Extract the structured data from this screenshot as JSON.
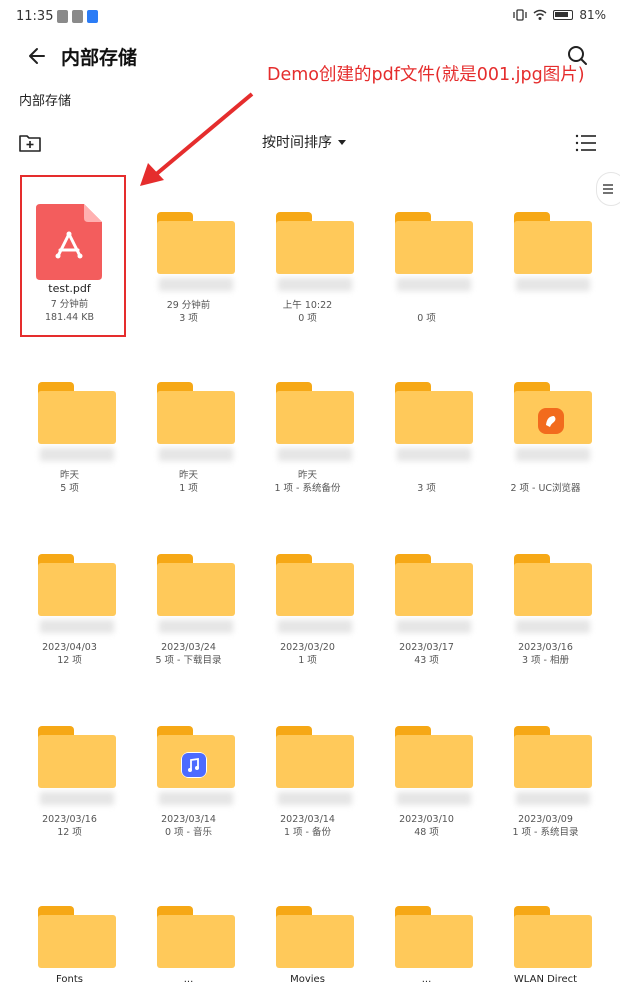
{
  "status_bar": {
    "time": "11:35",
    "battery": "81%"
  },
  "header": {
    "title": "内部存储"
  },
  "breadcrumb": {
    "path": "内部存储"
  },
  "toolbar": {
    "sort_label": "按时间排序"
  },
  "annotation": {
    "text": "Demo创建的pdf文件(就是001.jpg图片)"
  },
  "items": [
    {
      "name": "test.pdf",
      "date": "7 分钟前",
      "count": "181.44 KB"
    },
    {
      "name": "",
      "date": "29 分钟前",
      "count": "3 项"
    },
    {
      "name": "",
      "date": "上午 10:22",
      "count": "0 项"
    },
    {
      "name": "",
      "date": "",
      "count": "0 项"
    },
    {
      "name": "",
      "date": "",
      "count": ""
    },
    {
      "name": "",
      "date": "昨天",
      "count": "5 项"
    },
    {
      "name": "",
      "date": "昨天",
      "count": "1 项"
    },
    {
      "name": "",
      "date": "昨天",
      "count": "1 项 - 系统备份"
    },
    {
      "name": "",
      "date": "",
      "count": "3 项"
    },
    {
      "name": "",
      "date": "",
      "count": "2 项 - UC浏览器"
    },
    {
      "name": "",
      "date": "2023/04/03",
      "count": "12 项"
    },
    {
      "name": "",
      "date": "2023/03/24",
      "count": "5 项 - 下载目录"
    },
    {
      "name": "",
      "date": "2023/03/20",
      "count": "1 项"
    },
    {
      "name": "",
      "date": "2023/03/17",
      "count": "43 项"
    },
    {
      "name": "",
      "date": "2023/03/16",
      "count": "3 项 - 相册"
    },
    {
      "name": "",
      "date": "2023/03/16",
      "count": "12 项"
    },
    {
      "name": "",
      "date": "2023/03/14",
      "count": "0 项 - 音乐"
    },
    {
      "name": "",
      "date": "2023/03/14",
      "count": "1 项 - 备份"
    },
    {
      "name": "",
      "date": "2023/03/10",
      "count": "48 项"
    },
    {
      "name": "",
      "date": "2023/03/09",
      "count": "1 项 - 系统目录"
    }
  ],
  "bottom_names": [
    "Fonts",
    "...",
    "Movies",
    "...",
    "WLAN Direct"
  ],
  "colors": {
    "annotation": "#e52d2d",
    "folder": "#ffc95a",
    "folder_tab": "#f6a816",
    "pdf": "#f35d5d"
  }
}
